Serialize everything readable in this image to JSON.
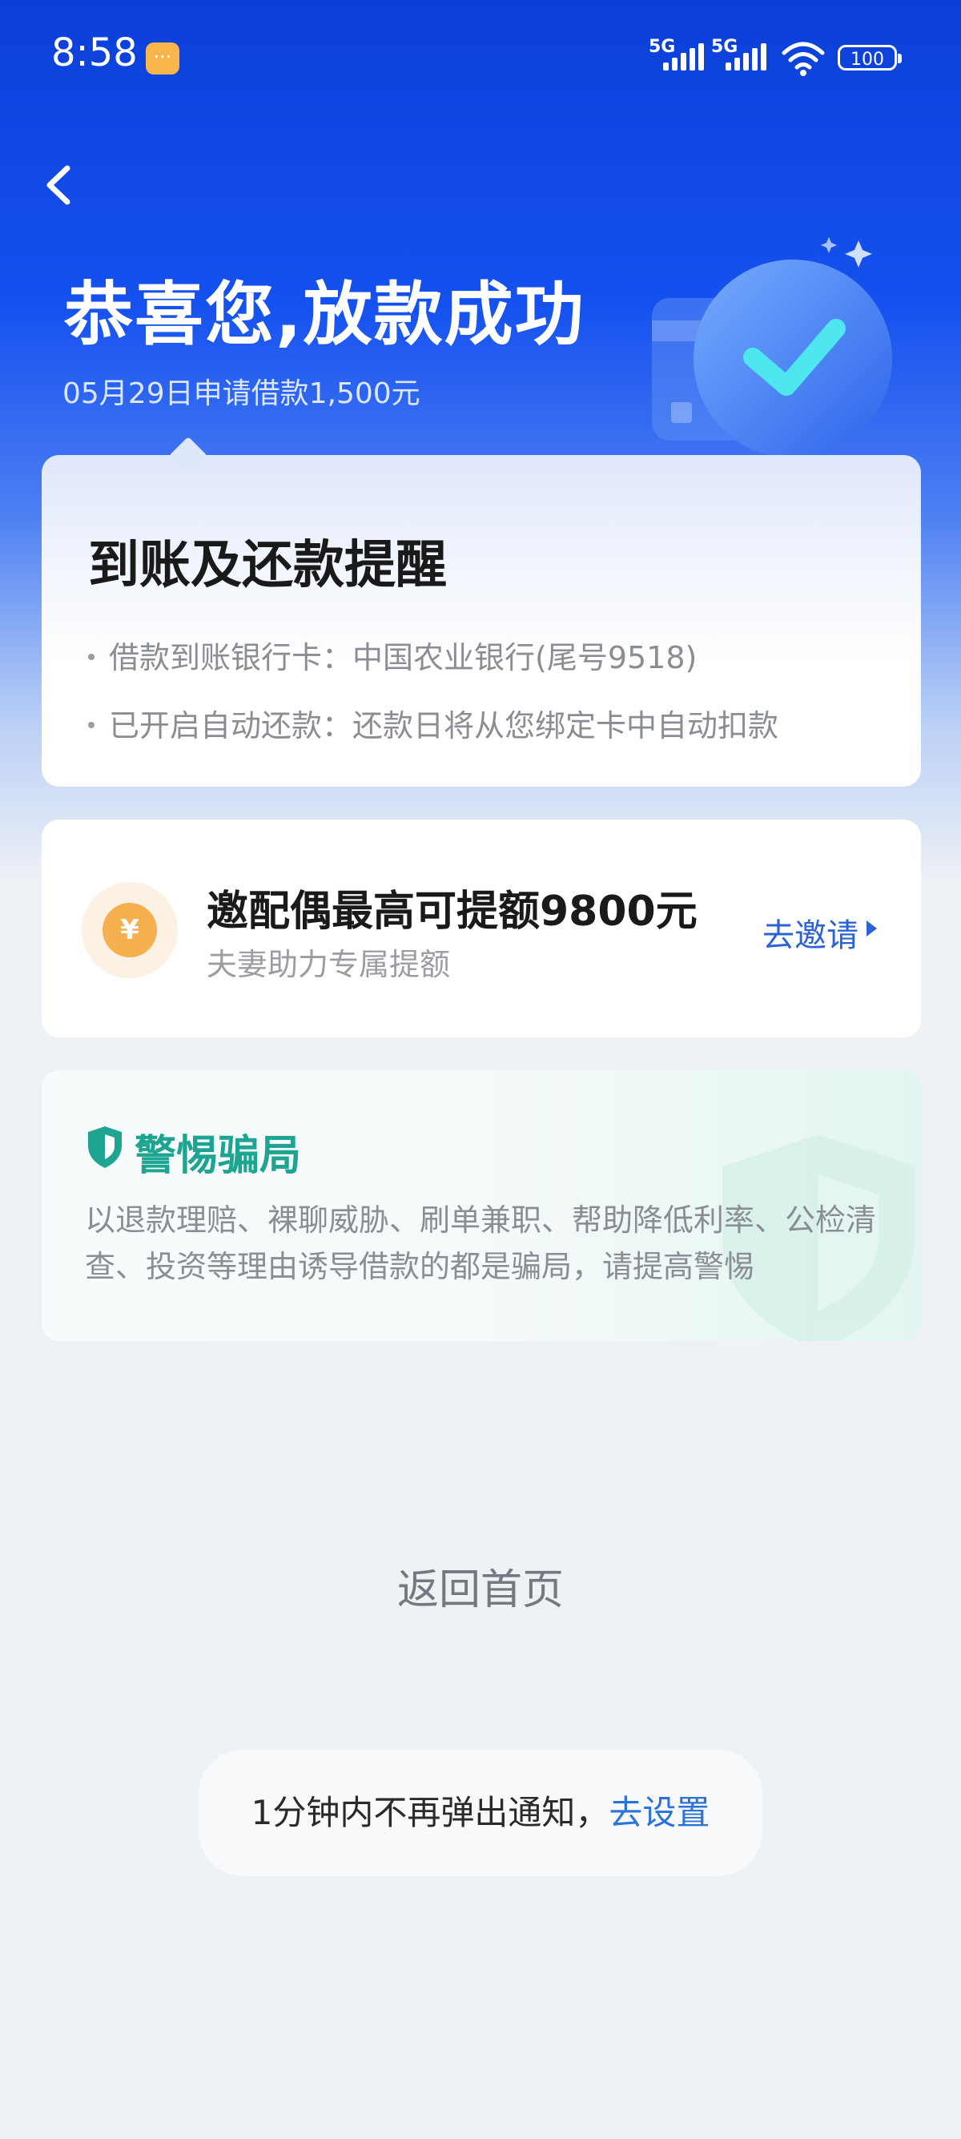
{
  "status_bar": {
    "time": "8:58",
    "signal1_label": "5G",
    "signal2_label": "5G",
    "battery": "100"
  },
  "header": {
    "title": "恭喜您,放款成功",
    "subtitle": "05月29日申请借款1,500元"
  },
  "reminder_card": {
    "title": "到账及还款提醒",
    "items": [
      "借款到账银行卡：中国农业银行(尾号9518)",
      "已开启自动还款：还款日将从您绑定卡中自动扣款"
    ]
  },
  "invite_card": {
    "coin_symbol": "¥",
    "title": "邀配偶最高可提额9800元",
    "subtitle": "夫妻助力专属提额",
    "action": "去邀请"
  },
  "warning_card": {
    "title": "警惕骗局",
    "text": "以退款理赔、裸聊威胁、刷单兼职、帮助降低利率、公检清查、投资等理由诱导借款的都是骗局，请提高警惕"
  },
  "home_link": "返回首页",
  "toast": {
    "text": "1分钟内不再弹出通知，",
    "link": "去设置"
  },
  "colors": {
    "brand_blue": "#1551ef",
    "link_blue": "#2b63d6",
    "warning_green": "#1da592",
    "coin_orange": "#f7b04f"
  }
}
